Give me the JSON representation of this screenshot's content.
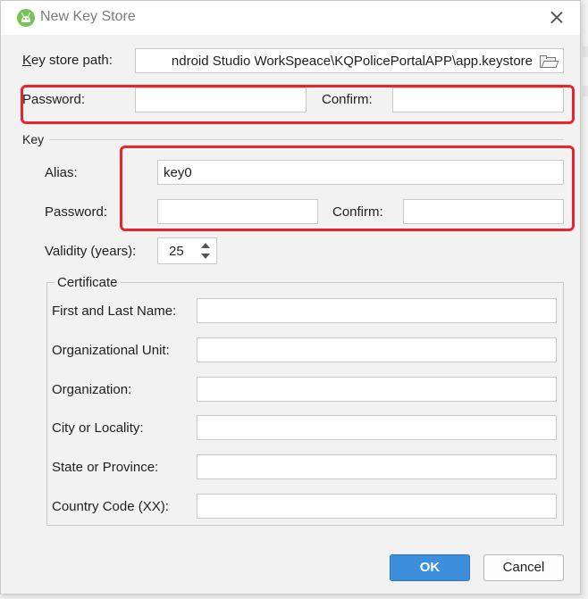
{
  "dialog": {
    "title": "New Key Store",
    "ok_label": "OK",
    "cancel_label": "Cancel"
  },
  "keystore": {
    "path_label": "Key store path:",
    "path_value": "ndroid Studio WorkSpeace\\KQPolicePortalAPP\\app.keystore",
    "password_label": "Password:",
    "password_value": "",
    "confirm_label": "Confirm:",
    "confirm_value": ""
  },
  "key": {
    "section_label": "Key",
    "alias_label": "Alias:",
    "alias_value": "key0",
    "password_label": "Password:",
    "password_value": "",
    "confirm_label": "Confirm:",
    "confirm_value": "",
    "validity_label": "Validity (years):",
    "validity_value": "25"
  },
  "certificate": {
    "legend": "Certificate",
    "fields": [
      {
        "label": "First and Last Name:",
        "value": ""
      },
      {
        "label": "Organizational Unit:",
        "value": ""
      },
      {
        "label": "Organization:",
        "value": ""
      },
      {
        "label": "City or Locality:",
        "value": ""
      },
      {
        "label": "State or Province:",
        "value": ""
      },
      {
        "label": "Country Code (XX):",
        "value": ""
      }
    ]
  },
  "colors": {
    "highlight": "#e8252a",
    "ok_button": "#3d8fdb",
    "android_icon": "#78c257"
  },
  "icons": [
    "android-studio-icon",
    "close-icon",
    "folder-icon",
    "spinner-up-icon",
    "spinner-down-icon"
  ]
}
